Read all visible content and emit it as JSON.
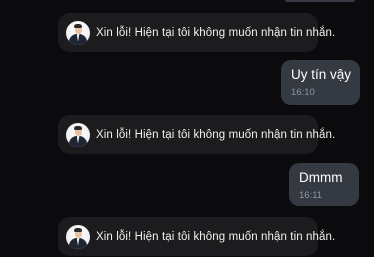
{
  "chat": {
    "messages": [
      {
        "type": "notice",
        "avatar": "avatar-man-in-suit",
        "text": "Xin lỗi! Hiện tại tôi không muốn nhận tin nhắn."
      },
      {
        "type": "outgoing",
        "text": "Uy tín vậy",
        "time": "16:10"
      },
      {
        "type": "notice",
        "avatar": "avatar-man-in-suit",
        "text": "Xin lỗi! Hiện tại tôi không muốn nhận tin nhắn."
      },
      {
        "type": "outgoing",
        "text": "Dmmm",
        "time": "16:11"
      },
      {
        "type": "notice",
        "avatar": "avatar-man-in-suit",
        "text": "Xin lỗi! Hiện tại tôi không muốn nhận tin nhắn."
      }
    ]
  },
  "colors": {
    "background": "#0b0b0d",
    "notice_bubble": "#1c1c1f",
    "outgoing_bubble": "#353941",
    "timestamp": "#8f94a0"
  }
}
